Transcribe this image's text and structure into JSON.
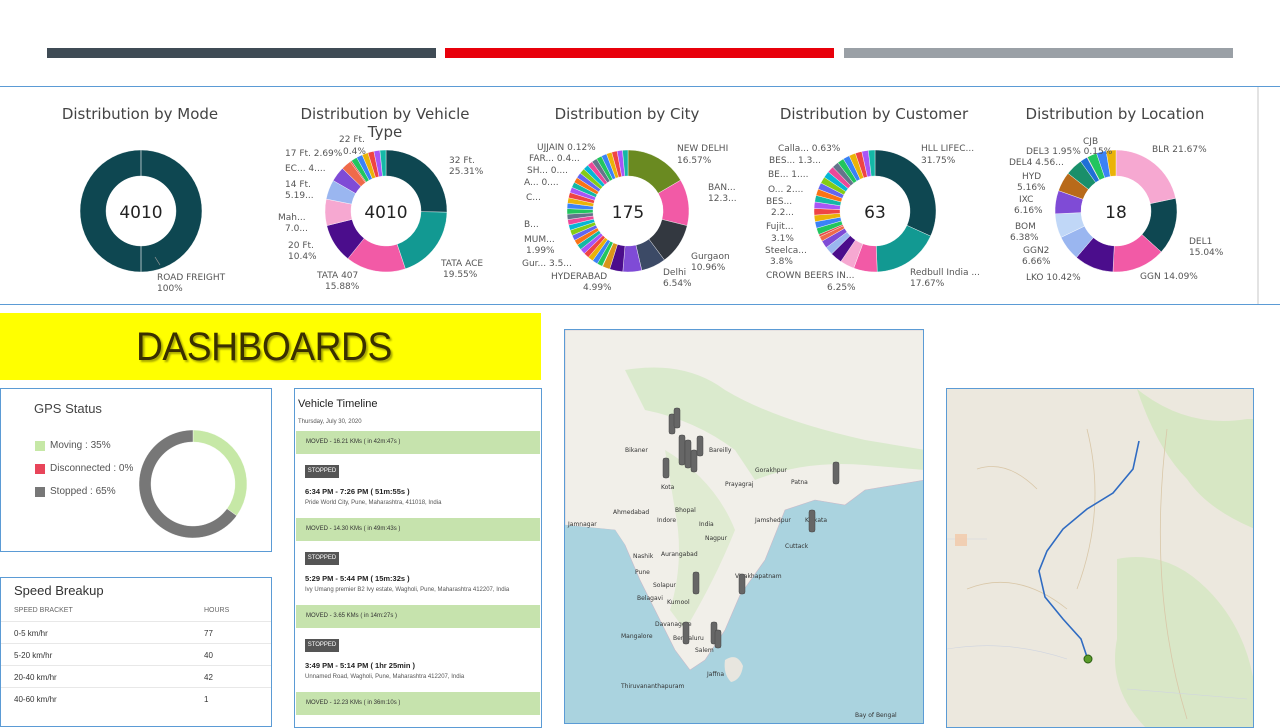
{
  "colors": {
    "bar_dark": "#3f4b55",
    "bar_red": "#e8000b",
    "bar_grey": "#9aa0a6",
    "border_blue": "#5b9bd5",
    "banner_yellow": "#ffff00",
    "moved_green": "#c6e3ad"
  },
  "charts": {
    "mode": {
      "title": "Distribution by Mode",
      "center": "4010",
      "labels": [
        "ROAD FREIGHT",
        "100%"
      ]
    },
    "vehicle": {
      "title": "Distribution by Vehicle Type",
      "center": "4010",
      "labels": {
        "l1a": "22 Ft.",
        "l1b": "0.4%",
        "l2": "17 Ft. 2.69%",
        "l3": "EC... 4....",
        "l4a": "14 Ft.",
        "l4b": "5.19...",
        "l5a": "Mah...",
        "l5b": "7.0...",
        "l6a": "20 Ft.",
        "l6b": "10.4%",
        "l7a": "TATA 407",
        "l7b": "15.88%",
        "l8a": "TATA ACE",
        "l8b": "19.55%",
        "l9a": "32 Ft.",
        "l9b": "25.31%"
      }
    },
    "city": {
      "title": "Distribution by City",
      "center": "175",
      "labels": {
        "l1": "UJJAIN 0.12%",
        "l2": "FAR... 0.4...",
        "l3": "SH... 0....",
        "l4": "A... 0....",
        "l5": "C...",
        "l6": "B...",
        "l7a": "MUM...",
        "l7b": "1.99%",
        "l8": "Gur... 3.5...",
        "l9a": "HYDERABAD",
        "l9b": "4.99%",
        "l10a": "Delhi",
        "l10b": "6.54%",
        "l11a": "Gurgaon",
        "l11b": "10.96%",
        "l12a": "BAN...",
        "l12b": "12.3...",
        "l13a": "NEW DELHI",
        "l13b": "16.57%"
      }
    },
    "customer": {
      "title": "Distribution by Customer",
      "center": "63",
      "labels": {
        "l1": "Calla... 0.63%",
        "l2": "BES... 1.3...",
        "l3": "BE... 1....",
        "l4": "O... 2....",
        "l5a": "BES...",
        "l5b": "2.2...",
        "l6a": "Fujit...",
        "l6b": "3.1%",
        "l7a": "Steelca...",
        "l7b": "3.8%",
        "l8a": "CROWN BEERS IN...",
        "l8b": "6.25%",
        "l9a": "Redbull India ...",
        "l9b": "17.67%",
        "l10a": "HLL LIFEC...",
        "l10b": "31.75%"
      }
    },
    "location": {
      "title": "Distribution by Location",
      "center": "18",
      "labels": {
        "l1": "CJB",
        "l2": "DEL3 1.95% 0.15%",
        "l3": "DEL4 4.56...",
        "l4a": "HYD",
        "l4b": "5.16%",
        "l5a": "IXC",
        "l5b": "6.16%",
        "l6a": "BOM",
        "l6b": "6.38%",
        "l7a": "GGN2",
        "l7b": "6.66%",
        "l8": "LKO 10.42%",
        "l9": "GGN 14.09%",
        "l10a": "DEL1",
        "l10b": "15.04%",
        "l11": "BLR 21.67%"
      }
    }
  },
  "chart_data": [
    {
      "type": "pie",
      "title": "Distribution by Mode",
      "categories": [
        "ROAD FREIGHT"
      ],
      "values": [
        100
      ],
      "total": 4010
    },
    {
      "type": "pie",
      "title": "Distribution by Vehicle Type",
      "categories": [
        "32 Ft.",
        "TATA ACE",
        "TATA 407",
        "20 Ft.",
        "Mah...",
        "14 Ft.",
        "EC...",
        "17 Ft.",
        "22 Ft."
      ],
      "values": [
        25.31,
        19.55,
        15.88,
        10.4,
        7.0,
        5.19,
        4.0,
        2.69,
        0.4
      ],
      "total": 4010
    },
    {
      "type": "pie",
      "title": "Distribution by City",
      "categories": [
        "NEW DELHI",
        "BAN...",
        "Gurgaon",
        "Delhi",
        "HYDERABAD",
        "Gur...",
        "MUM...",
        "UJJAIN"
      ],
      "values": [
        16.57,
        12.3,
        10.96,
        6.54,
        4.99,
        3.5,
        1.99,
        0.12
      ],
      "total": 175
    },
    {
      "type": "pie",
      "title": "Distribution by Customer",
      "categories": [
        "HLL LIFEC...",
        "Redbull India ...",
        "CROWN BEERS IN...",
        "Steelca...",
        "Fujit...",
        "BES...",
        "O...",
        "BES...",
        "Calla..."
      ],
      "values": [
        31.75,
        17.67,
        6.25,
        3.8,
        3.1,
        2.2,
        2.0,
        1.3,
        0.63
      ],
      "total": 63
    },
    {
      "type": "pie",
      "title": "Distribution by Location",
      "categories": [
        "BLR",
        "DEL1",
        "GGN",
        "LKO",
        "GGN2",
        "BOM",
        "IXC",
        "HYD",
        "DEL4",
        "DEL3",
        "CJB"
      ],
      "values": [
        21.67,
        15.04,
        14.09,
        10.42,
        6.66,
        6.38,
        6.16,
        5.16,
        4.56,
        1.95,
        0.15
      ],
      "total": 18
    },
    {
      "type": "pie",
      "title": "GPS Status",
      "categories": [
        "Moving",
        "Disconnected",
        "Stopped"
      ],
      "values": [
        35,
        0,
        65
      ]
    },
    {
      "type": "table",
      "title": "Speed Breakup",
      "categories": [
        "0-5 km/hr",
        "5-20 km/hr",
        "20-40 km/hr",
        "40-60 km/hr"
      ],
      "values": [
        77,
        40,
        42,
        1
      ]
    }
  ],
  "banner": {
    "text": "DASHBOARDS"
  },
  "gps": {
    "title": "GPS Status",
    "moving": "Moving : 35%",
    "disconnected": "Disconnected : 0%",
    "stopped": "Stopped : 65%",
    "moving_color": "#c6e8a6",
    "disconnected_color": "#e8455a",
    "stopped_color": "#777777"
  },
  "speed": {
    "title": "Speed Breakup",
    "col1": "SPEED BRACKET",
    "col2": "HOURS",
    "rows": [
      {
        "bracket": "0-5 km/hr",
        "hours": "77"
      },
      {
        "bracket": "5-20 km/hr",
        "hours": "40"
      },
      {
        "bracket": "20-40 km/hr",
        "hours": "42"
      },
      {
        "bracket": "40-60 km/hr",
        "hours": "1"
      }
    ]
  },
  "timeline": {
    "title": "Vehicle Timeline",
    "date": "Thursday, July 30, 2020",
    "moved1": "MOVED - 16.21 KMs ( in 42m:47s )",
    "stopped_label": "STOPPED",
    "stop1_time": "6:34 PM - 7:26 PM ( 51m:55s )",
    "stop1_addr": "Pride World City, Pune, Maharashtra, 411018, India",
    "moved2": "MOVED - 14.30 KMs ( in 49m:43s )",
    "stop2_time": "5:29 PM - 5:44 PM ( 15m:32s )",
    "stop2_addr": "Ivy Umang premier B2 Ivy estate, Wagholi, Pune, Maharashtra 412207, India",
    "moved3": "MOVED - 3.65 KMs ( in 14m:27s )",
    "stop3_time": "3:49 PM - 5:14 PM ( 1hr 25min )",
    "stop3_addr": "Unnamed Road, Wagholi, Pune, Maharashtra 412207, India",
    "moved4": "MOVED - 12.23 KMs ( in 36m:10s )"
  },
  "map": {
    "labels": [
      "Bikaner",
      "Bareilly",
      "Gorakhpur",
      "Kota",
      "Prayagraj",
      "Ahmedabad",
      "Bhopal",
      "India",
      "Jamshedpur",
      "Nagpur",
      "Cuttack",
      "Nashik",
      "Aurangabad",
      "Pune",
      "Solapur",
      "Visakhapatnam",
      "Belagavi",
      "Kurnool",
      "Mangalore",
      "Davanagere",
      "Bengaluru",
      "Salem",
      "Jaffna",
      "Thiruvananthapuram",
      "Indore",
      "Jamnagar",
      "Patna",
      "Kolkata",
      "Bay of Bengal"
    ]
  }
}
